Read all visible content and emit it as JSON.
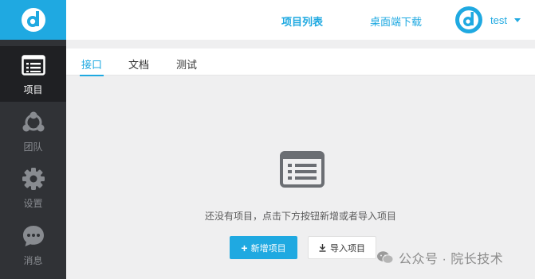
{
  "header": {
    "links": [
      "项目列表",
      "桌面端下载"
    ],
    "user": {
      "name": "test"
    }
  },
  "sidebar": {
    "items": [
      {
        "label": "项目",
        "icon": "project-list-icon",
        "active": true
      },
      {
        "label": "团队",
        "icon": "team-icon",
        "active": false
      },
      {
        "label": "设置",
        "icon": "gear-icon",
        "active": false
      },
      {
        "label": "消息",
        "icon": "chat-icon",
        "active": false
      }
    ]
  },
  "tabs": [
    {
      "label": "接口",
      "active": true
    },
    {
      "label": "文档",
      "active": false
    },
    {
      "label": "测试",
      "active": false
    }
  ],
  "empty": {
    "text": "还没有项目，点击下方按钮新增或者导入项目",
    "add_button": "新增项目",
    "import_button": "导入项目"
  },
  "watermark": {
    "text": "公众号 · 院长技术"
  },
  "colors": {
    "accent": "#1fa9e1",
    "sidebar": "#303236",
    "sidebar_active": "#1f2023"
  }
}
